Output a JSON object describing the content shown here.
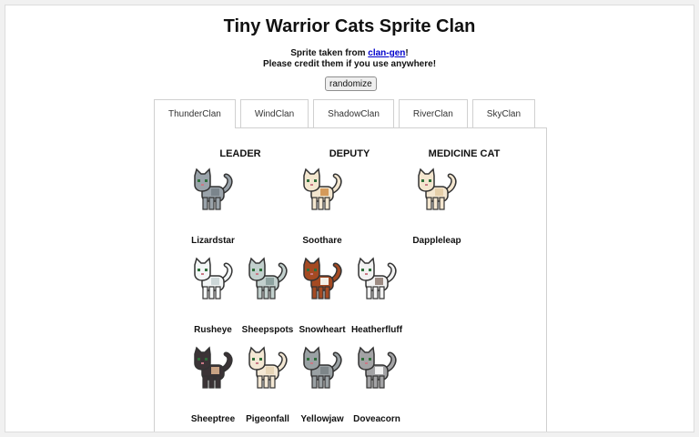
{
  "title": "Tiny Warrior Cats Sprite Clan",
  "credit": {
    "prefix": "Sprite taken from ",
    "link_text": "clan-gen",
    "suffix": "!",
    "line2": "Please credit them if you use anywhere!"
  },
  "randomize_label": "randomize",
  "tabs": [
    "ThunderClan",
    "WindClan",
    "ShadowClan",
    "RiverClan",
    "SkyClan"
  ],
  "active_tab": "ThunderClan",
  "roles": {
    "leader": "LEADER",
    "deputy": "DEPUTY",
    "medicine": "MEDICINE CAT"
  },
  "cats": [
    {
      "name": "Lizardstar",
      "fur": "#9aa3aa",
      "accent": "#7b858c"
    },
    {
      "name": "Soothare",
      "fur": "#f3e6cf",
      "accent": "#d49a5b"
    },
    {
      "name": "Dappleleap",
      "fur": "#f4e6cf",
      "accent": "#e6cfa9"
    },
    {
      "name": "Rusheye",
      "fur": "#f3f6f6",
      "accent": "#cdd7d8"
    },
    {
      "name": "Sheepspots",
      "fur": "#c2d0cd",
      "accent": "#8ea3a0"
    },
    {
      "name": "Snowheart",
      "fur": "#a54a22",
      "accent": "#f4efe6"
    },
    {
      "name": "Heatherfluff",
      "fur": "#f2f2f2",
      "accent": "#9c8b83"
    },
    {
      "name": "Sheeptree",
      "fur": "#3b3336",
      "accent": "#c9a283"
    },
    {
      "name": "Pigeonfall",
      "fur": "#f4e8d4",
      "accent": "#e8d6b8"
    },
    {
      "name": "Yellowjaw",
      "fur": "#9aa1a4",
      "accent": "#7e8689"
    },
    {
      "name": "Doveacorn",
      "fur": "#a3a3a5",
      "accent": "#f2f2f2"
    }
  ]
}
